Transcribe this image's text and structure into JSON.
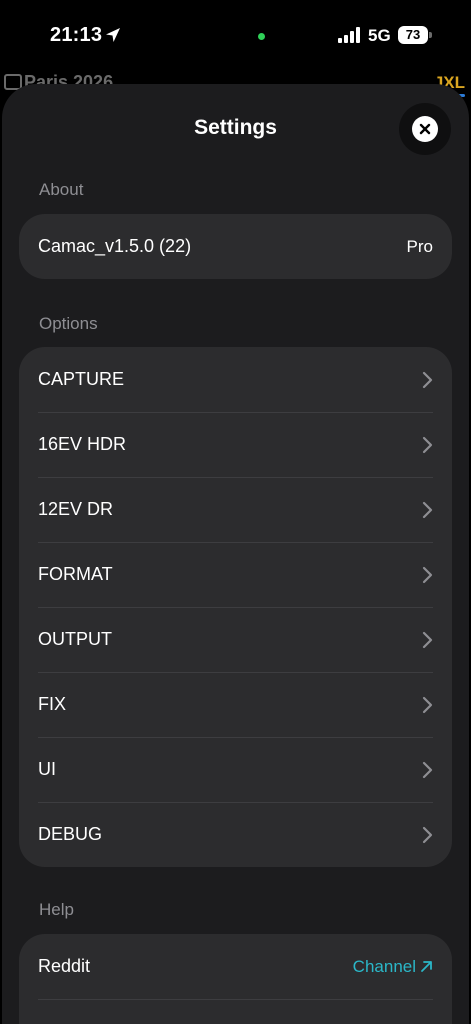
{
  "status_bar": {
    "time": "21:13",
    "network": "5G",
    "battery": "73",
    "location_icon": "location-arrow-icon",
    "signal_icon": "cellular-signal-icon"
  },
  "background_app": {
    "title": "Paris 2026",
    "badge": "JXL"
  },
  "sheet": {
    "title": "Settings",
    "close_icon": "close-icon"
  },
  "about": {
    "label": "About",
    "app_version": "Camac_v1.5.0 (22)",
    "tier": "Pro"
  },
  "options": {
    "label": "Options",
    "items": [
      {
        "label": "CAPTURE"
      },
      {
        "label": "16EV HDR"
      },
      {
        "label": "12EV DR"
      },
      {
        "label": "FORMAT"
      },
      {
        "label": "OUTPUT"
      },
      {
        "label": "FIX"
      },
      {
        "label": "UI"
      },
      {
        "label": "DEBUG"
      }
    ]
  },
  "help": {
    "label": "Help",
    "items": [
      {
        "label": "Reddit",
        "link": "Channel"
      }
    ]
  },
  "colors": {
    "accent_link": "#2bb7c8",
    "sheet_bg": "#1c1c1e",
    "group_bg": "#2c2c2e"
  }
}
